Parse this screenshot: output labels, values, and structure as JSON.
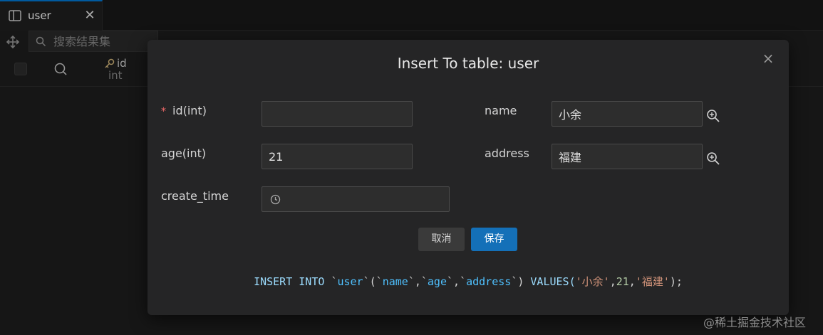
{
  "tab": {
    "label": "user",
    "close": "✕"
  },
  "toolbar": {
    "search_placeholder": "搜索结果集"
  },
  "grid": {
    "columns": [
      {
        "name": "id",
        "type": "int"
      }
    ]
  },
  "modal": {
    "title": "Insert To table: user",
    "close": "×",
    "fields": {
      "id": {
        "label": "id(int)",
        "value": "",
        "required": "*"
      },
      "name": {
        "label": "name",
        "value": "小余"
      },
      "age": {
        "label": "age(int)",
        "value": "21"
      },
      "address": {
        "label": "address",
        "value": "福建"
      },
      "create_time": {
        "label": "create_time",
        "value": ""
      }
    },
    "buttons": {
      "cancel": "取消",
      "save": "保存"
    },
    "sql": {
      "insert_into": "INSERT INTO ",
      "table": "user",
      "col1": "name",
      "col2": "age",
      "col3": "address",
      "values_kw": " VALUES(",
      "v1": "'小余'",
      "v2": "21",
      "v3": "'福建'",
      "end": ");"
    }
  },
  "watermark": "@稀土掘金技术社区",
  "colors": {
    "accent": "#1470b8",
    "tab_indicator": "#0078d4",
    "required": "#f56c6c"
  }
}
